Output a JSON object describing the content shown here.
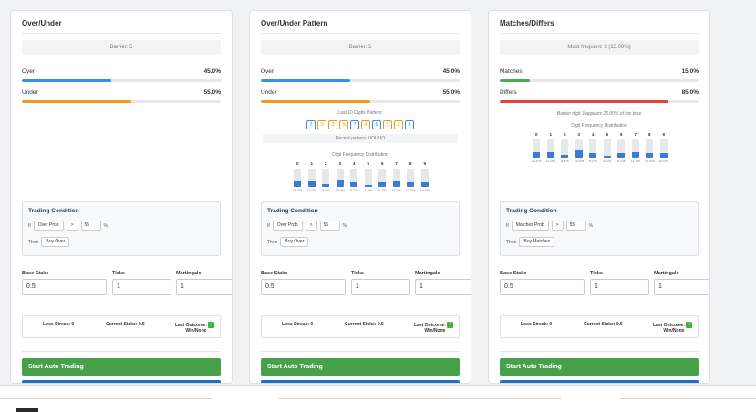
{
  "colors": {
    "over": "#2f94e3",
    "under": "#f29a1f",
    "matches": "#45b04a",
    "differs": "#e0443c",
    "button": "#46a149"
  },
  "cards": {
    "ou": {
      "title": "Over/Under",
      "barrier": "Barrier: 5",
      "over_label": "Over",
      "over_value": "45.0%",
      "over_fraction": 0.45,
      "under_label": "Under",
      "under_value": "55.0%",
      "under_fraction": 0.55,
      "cond_title": "Trading Condition",
      "if_label": "If",
      "select": "Over Prob",
      "op": ">",
      "threshold": "55",
      "pct": "%",
      "then_label": "Then",
      "action": "Buy Over",
      "stake_label": "Base Stake",
      "stake": "0.5",
      "ticks_label": "Ticks",
      "ticks": "1",
      "mart_label": "Martingale",
      "mart": "1",
      "loss_streak": "Loss Streak: 0",
      "current_stake": "Current Stake: 0.5",
      "last_outcome": "Last Outcome:",
      "last_outcome_2": "Win/None",
      "start": "Start Auto Trading"
    },
    "pat": {
      "title": "Over/Under Pattern",
      "barrier": "Barrier: 5",
      "over_label": "Over",
      "over_value": "45.0%",
      "over_fraction": 0.45,
      "under_label": "Under",
      "under_value": "55.0%",
      "under_fraction": 0.55,
      "last_digits_label": "Last 10 Digits Pattern:",
      "digits": [
        {
          "d": "7",
          "type": "over"
        },
        {
          "d": "0",
          "type": "under"
        },
        {
          "d": "3",
          "type": "under"
        },
        {
          "d": "5",
          "type": "under"
        },
        {
          "d": "7",
          "type": "over"
        },
        {
          "d": "4",
          "type": "under"
        },
        {
          "d": "6",
          "type": "over"
        },
        {
          "d": "2",
          "type": "under"
        },
        {
          "d": "3",
          "type": "under"
        },
        {
          "d": "8",
          "type": "over"
        }
      ],
      "recent_pattern": "Recent pattern: UOUUO",
      "dist_title": "Digit Frequency Distribution",
      "dist": [
        {
          "d": "0",
          "p": "12.0%",
          "v": 12.0
        },
        {
          "d": "1",
          "p": "12.0%",
          "v": 12.0
        },
        {
          "d": "2",
          "p": "5.8%",
          "v": 5.8
        },
        {
          "d": "3",
          "p": "15.0%",
          "v": 15.0
        },
        {
          "d": "4",
          "p": "9.2%",
          "v": 9.2
        },
        {
          "d": "5",
          "p": "4.2%",
          "v": 4.2
        },
        {
          "d": "6",
          "p": "9.2%",
          "v": 9.2
        },
        {
          "d": "7",
          "p": "11.7%",
          "v": 11.7
        },
        {
          "d": "8",
          "p": "10.0%",
          "v": 10.0
        },
        {
          "d": "9",
          "p": "10.0%",
          "v": 10.0
        }
      ],
      "cond_title": "Trading Condition",
      "if_label": "If",
      "select": "Over Prob",
      "op": ">",
      "threshold": "55",
      "pct": "%",
      "then_label": "Then",
      "action": "Buy Over",
      "stake_label": "Base Stake",
      "stake": "0.5",
      "ticks_label": "Ticks",
      "ticks": "1",
      "mart_label": "Martingale",
      "mart": "1",
      "loss_streak": "Loss Streak: 0",
      "current_stake": "Current Stake: 0.5",
      "last_outcome": "Last Outcome:",
      "last_outcome_2": "Win/None",
      "start": "Start Auto Trading"
    },
    "md": {
      "title": "Matches/Differs",
      "barrier": "Most frequent: 3 (15.00%)",
      "over_label": "Matches",
      "over_value": "15.0%",
      "over_fraction": 0.15,
      "under_label": "Differs",
      "under_value": "85.0%",
      "under_fraction": 0.85,
      "barrier_note": "Barrier digit 3 appears 15.00% of the time",
      "dist_title": "Digit Frequency Distribution",
      "dist": [
        {
          "d": "0",
          "p": "12.0%",
          "v": 12.0
        },
        {
          "d": "1",
          "p": "12.0%",
          "v": 12.0
        },
        {
          "d": "2",
          "p": "5.8%",
          "v": 5.8
        },
        {
          "d": "3",
          "p": "15.0%",
          "v": 15.0
        },
        {
          "d": "4",
          "p": "9.2%",
          "v": 9.2
        },
        {
          "d": "5",
          "p": "4.2%",
          "v": 4.2
        },
        {
          "d": "6",
          "p": "9.2%",
          "v": 9.2
        },
        {
          "d": "7",
          "p": "11.7%",
          "v": 11.7
        },
        {
          "d": "8",
          "p": "10.0%",
          "v": 10.0
        },
        {
          "d": "9",
          "p": "10.0%",
          "v": 10.0
        }
      ],
      "cond_title": "Trading Condition",
      "if_label": "If",
      "select": "Matches Prob",
      "op": ">",
      "threshold": "55",
      "pct": "%",
      "then_label": "Then",
      "action": "Buy Matches",
      "stake_label": "Base Stake",
      "stake": "0.5",
      "ticks_label": "Ticks",
      "ticks": "1",
      "mart_label": "Martingale",
      "mart": "1",
      "loss_streak": "Loss Streak: 0",
      "current_stake": "Current Stake: 0.5",
      "last_outcome": "Last Outcome:",
      "last_outcome_2": "Win/None",
      "start": "Start Auto Trading"
    }
  }
}
